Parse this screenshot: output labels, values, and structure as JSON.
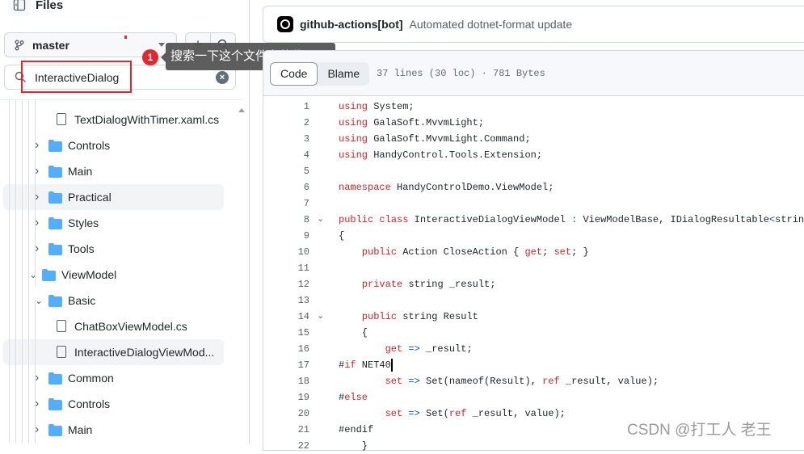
{
  "sidebar": {
    "title": "Files",
    "branch": "master",
    "search": {
      "value": "InteractiveDialog"
    },
    "tree": [
      {
        "label": "TextDialogWithTimer.xaml.cs",
        "type": "file",
        "depth": 3
      },
      {
        "label": "Controls",
        "type": "folder",
        "depth": 2,
        "expanded": false
      },
      {
        "label": "Main",
        "type": "folder",
        "depth": 2,
        "expanded": false
      },
      {
        "label": "Practical",
        "type": "folder",
        "depth": 2,
        "expanded": false,
        "hover": true
      },
      {
        "label": "Styles",
        "type": "folder",
        "depth": 2,
        "expanded": false
      },
      {
        "label": "Tools",
        "type": "folder",
        "depth": 2,
        "expanded": false
      },
      {
        "label": "ViewModel",
        "type": "folder",
        "depth": 1,
        "expanded": true
      },
      {
        "label": "Basic",
        "type": "folder",
        "depth": 2,
        "expanded": true
      },
      {
        "label": "ChatBoxViewModel.cs",
        "type": "file",
        "depth": 3
      },
      {
        "label": "InteractiveDialogViewMod...",
        "type": "file",
        "depth": 3,
        "selected": true
      },
      {
        "label": "Common",
        "type": "folder",
        "depth": 2,
        "expanded": false
      },
      {
        "label": "Controls",
        "type": "folder",
        "depth": 2,
        "expanded": false
      },
      {
        "label": "Main",
        "type": "folder",
        "depth": 2,
        "expanded": false
      }
    ]
  },
  "annotation": {
    "badge": "1",
    "tooltip": "搜索一下这个文件名的代码",
    "highlight_color": "#e5262c"
  },
  "commit": {
    "author": "github-actions[bot]",
    "message": "Automated dotnet-format update"
  },
  "toolbar": {
    "tabs": [
      "Code",
      "Blame"
    ],
    "active": "Code",
    "meta": "37 lines (30 loc) · 781 Bytes"
  },
  "code": [
    {
      "n": "1",
      "t": [
        [
          "k",
          "using"
        ],
        [
          "",
          "  System;"
        ]
      ]
    },
    {
      "n": "2",
      "t": [
        [
          "k",
          "using"
        ],
        [
          "",
          " GalaSoft.MvvmLight;"
        ]
      ]
    },
    {
      "n": "3",
      "t": [
        [
          "k",
          "using"
        ],
        [
          "",
          " GalaSoft.MvvmLight.Command;"
        ]
      ]
    },
    {
      "n": "4",
      "t": [
        [
          "k",
          "using"
        ],
        [
          "",
          " HandyControl.Tools.Extension;"
        ]
      ]
    },
    {
      "n": "5",
      "t": []
    },
    {
      "n": "6",
      "t": [
        [
          "k",
          "namespace"
        ],
        [
          "",
          " HandyControlDemo.ViewModel;"
        ]
      ]
    },
    {
      "n": "7",
      "t": []
    },
    {
      "n": "8",
      "fold": true,
      "t": [
        [
          "k",
          "public"
        ],
        [
          "",
          " "
        ],
        [
          "k",
          "class"
        ],
        [
          "",
          " InteractiveDialogViewModel "
        ],
        [
          "o",
          ":"
        ],
        [
          "",
          " ViewModelBase, IDialogResultable"
        ],
        [
          "o",
          "<"
        ],
        [
          "",
          "string"
        ]
      ]
    },
    {
      "n": "9",
      "t": [
        [
          "",
          "{"
        ]
      ]
    },
    {
      "n": "10",
      "t": [
        [
          "",
          "    "
        ],
        [
          "k",
          "public"
        ],
        [
          "",
          " Action CloseAction { "
        ],
        [
          "k",
          "get"
        ],
        [
          "",
          "; "
        ],
        [
          "k",
          "set"
        ],
        [
          "",
          "; }"
        ]
      ]
    },
    {
      "n": "11",
      "t": []
    },
    {
      "n": "12",
      "t": [
        [
          "",
          "    "
        ],
        [
          "k",
          "private"
        ],
        [
          "",
          " string _result;"
        ]
      ]
    },
    {
      "n": "13",
      "t": []
    },
    {
      "n": "14",
      "fold": true,
      "t": [
        [
          "",
          "    "
        ],
        [
          "k",
          "public"
        ],
        [
          "",
          " string Result"
        ]
      ]
    },
    {
      "n": "15",
      "t": [
        [
          "",
          "    {"
        ]
      ]
    },
    {
      "n": "16",
      "t": [
        [
          "",
          "        "
        ],
        [
          "k",
          "get"
        ],
        [
          "",
          " "
        ],
        [
          "o",
          "=>"
        ],
        [
          "",
          " _result;"
        ]
      ]
    },
    {
      "n": "17",
      "cursor": true,
      "t": [
        [
          "",
          "#"
        ],
        [
          "k",
          "if"
        ],
        [
          "",
          " NET40"
        ]
      ]
    },
    {
      "n": "18",
      "t": [
        [
          "",
          "        "
        ],
        [
          "k",
          "set"
        ],
        [
          "",
          " "
        ],
        [
          "o",
          "=>"
        ],
        [
          "",
          " Set(nameof(Result), "
        ],
        [
          "k",
          "ref"
        ],
        [
          "",
          " _result, value);"
        ]
      ]
    },
    {
      "n": "19",
      "t": [
        [
          "",
          "#"
        ],
        [
          "k",
          "else"
        ]
      ]
    },
    {
      "n": "20",
      "t": [
        [
          "",
          "        "
        ],
        [
          "k",
          "set"
        ],
        [
          "",
          " "
        ],
        [
          "o",
          "=>"
        ],
        [
          "",
          " Set("
        ],
        [
          "k",
          "ref"
        ],
        [
          "",
          " _result, value);"
        ]
      ]
    },
    {
      "n": "21",
      "t": [
        [
          "",
          "#endif"
        ]
      ]
    },
    {
      "n": "22",
      "t": [
        [
          "",
          "    }"
        ]
      ]
    }
  ],
  "watermark": "CSDN @打工人 老王"
}
